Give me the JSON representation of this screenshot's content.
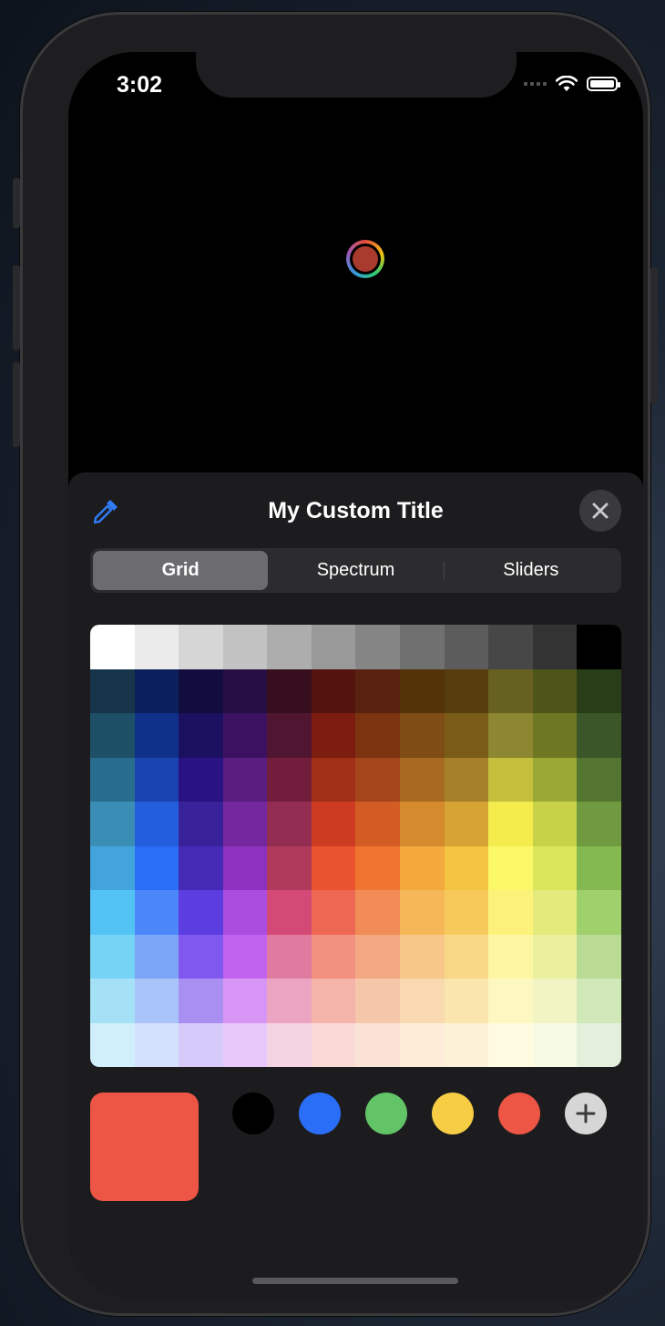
{
  "status_bar": {
    "time": "3:02"
  },
  "color_well": {
    "selected_color": "#a93a2e"
  },
  "sheet": {
    "title": "My Custom Title",
    "eyedropper_icon": "eyedropper-icon",
    "close_icon": "close-icon"
  },
  "segmented_control": {
    "options": [
      "Grid",
      "Spectrum",
      "Sliders"
    ],
    "selected": "Grid"
  },
  "grid_colors": [
    [
      "#ffffff",
      "#ebebeb",
      "#d6d6d6",
      "#c2c2c2",
      "#adadad",
      "#999999",
      "#858585",
      "#707070",
      "#5c5c5c",
      "#474747",
      "#333333",
      "#000000"
    ],
    [
      "#16354a",
      "#0b1f5c",
      "#120c3f",
      "#270e42",
      "#360e1e",
      "#54130e",
      "#572310",
      "#553309",
      "#553d0d",
      "#666021",
      "#4d5518",
      "#283d18"
    ],
    [
      "#1d4f66",
      "#10318a",
      "#1b1160",
      "#3d1161",
      "#501530",
      "#7c1d10",
      "#7c3310",
      "#7e4c14",
      "#7a5b18",
      "#8c8730",
      "#6e7722",
      "#3b5629"
    ],
    [
      "#296d8e",
      "#1a45b0",
      "#291281",
      "#5a1e80",
      "#731d3d",
      "#a02f18",
      "#a5451b",
      "#a86a21",
      "#a67f2a",
      "#c5bf3e",
      "#9ba834",
      "#54752f"
    ],
    [
      "#3a8db5",
      "#235edd",
      "#382299",
      "#7527a0",
      "#942d52",
      "#cc3b22",
      "#d35b24",
      "#d48a2d",
      "#d6a335",
      "#f4eb4d",
      "#c7d249",
      "#6f9a3f"
    ],
    [
      "#43a3dd",
      "#2a6df7",
      "#452ab5",
      "#8c32be",
      "#b03a5b",
      "#e9532d",
      "#f07530",
      "#f4a93c",
      "#f3c342",
      "#fbf967",
      "#dce65b",
      "#84b850"
    ],
    [
      "#53c2f5",
      "#4b87f8",
      "#5b3de0",
      "#ab4ee0",
      "#d34a76",
      "#ee6752",
      "#f28c56",
      "#f5b757",
      "#f6c95a",
      "#fcf27a",
      "#e4ea7c",
      "#a0d06c"
    ],
    [
      "#76d3f6",
      "#7ba5f7",
      "#8058ef",
      "#c263ef",
      "#e07b9f",
      "#f1907f",
      "#f4a882",
      "#f7c78a",
      "#f8d787",
      "#fdf6a2",
      "#ebf09f",
      "#badb94"
    ],
    [
      "#a4e1f7",
      "#a9c4f8",
      "#aa8ff3",
      "#d796f5",
      "#eba5c3",
      "#f5b4aa",
      "#f6c6ab",
      "#f9d9af",
      "#fae5ae",
      "#fdf8c2",
      "#f2f5c3",
      "#d1e8b8"
    ],
    [
      "#d0effb",
      "#d4e1fc",
      "#d6cafb",
      "#e8c8fa",
      "#f4d3e2",
      "#f9dad5",
      "#fae3d6",
      "#fcecd8",
      "#fcf2d7",
      "#fefbe1",
      "#f7fae3",
      "#e4f0dc"
    ]
  ],
  "current_color": "#ed5545",
  "saved_swatches": [
    "#000000",
    "#2a6df7",
    "#62c466",
    "#f6cd44",
    "#ed5545"
  ],
  "add_swatch_icon": "plus-icon"
}
